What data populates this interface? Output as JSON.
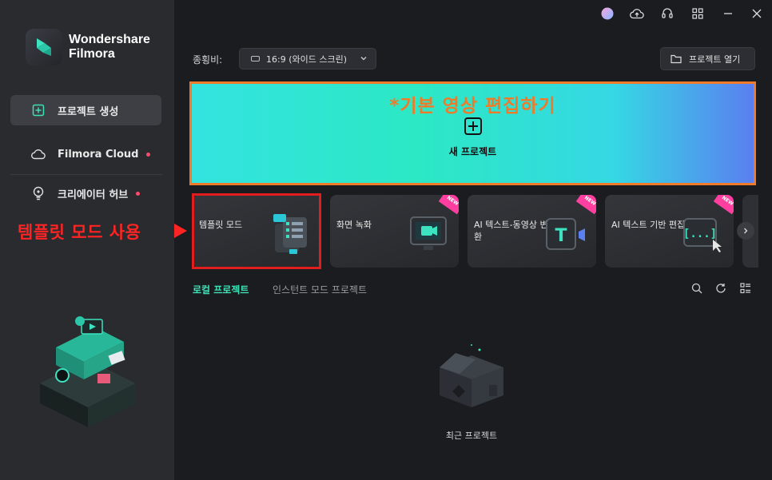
{
  "app": {
    "brand_line1": "Wondershare",
    "brand_line2": "Filmora"
  },
  "sidebar": {
    "items": [
      {
        "label": "프로젝트 생성",
        "icon": "new-project-icon",
        "active": true
      },
      {
        "label": "Filmora Cloud",
        "icon": "cloud-icon",
        "dot": true
      },
      {
        "label": "크리에이터 허브",
        "icon": "lightbulb-icon",
        "dot": true
      }
    ]
  },
  "titlebar": {
    "icons": [
      "profile-avatar-icon",
      "cloud-upload-icon",
      "headset-icon",
      "grid-icon",
      "minimize-icon",
      "close-icon"
    ]
  },
  "ratio": {
    "label": "종횡비:",
    "value": "16:9 (와이드 스크린)"
  },
  "open_project": {
    "label": "프로젝트 열기"
  },
  "new_project": {
    "annotation": "*기본 영상 편집하기",
    "label": "새 프로젝트"
  },
  "cards": [
    {
      "label": "템플릿 모드",
      "new": false
    },
    {
      "label": "화면 녹화",
      "new": true
    },
    {
      "label": "AI 텍스트-동영상 변환",
      "new": true
    },
    {
      "label": "AI 텍스트 기반 편집",
      "new": true
    }
  ],
  "new_tag": "NEW",
  "annotations": {
    "template_mode": "템플릿 모드 사용"
  },
  "tabs": {
    "local": "로컬 프로젝트",
    "instant": "인스턴트 모드 프로젝트"
  },
  "empty_state": {
    "label": "최근 프로젝트"
  },
  "colors": {
    "accent": "#3fe0b5",
    "annotation_orange": "#ef7b2a",
    "annotation_red": "#ff2424",
    "new_badge": "#ff3fa0"
  }
}
